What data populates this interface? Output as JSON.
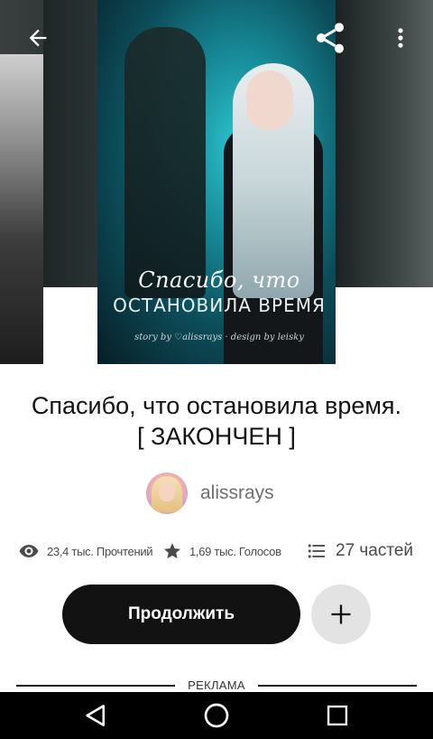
{
  "header": {
    "back_icon": "arrow-left-icon",
    "share_icon": "share-icon",
    "more_icon": "more-vertical-icon"
  },
  "cover": {
    "title_line1": "Спасибо, что",
    "title_line2": "ОСТАНОВИЛА ВРЕМЯ",
    "credit": "story by ♡alissrays · design by leisky"
  },
  "story": {
    "title": "Спасибо, что остановила время. [ ЗАКОНЧЕН ]"
  },
  "author": {
    "name": "alissrays"
  },
  "stats": {
    "reads": "23,4 тыс. Прочтений",
    "votes": "1,69 тыс. Голосов",
    "parts": "27 частей"
  },
  "actions": {
    "continue_label": "Продолжить",
    "add_icon": "plus-icon"
  },
  "ad": {
    "label": "РЕКЛАМА"
  },
  "nav_bar": {
    "back_icon": "nav-back-icon",
    "home_icon": "nav-home-icon",
    "recent_icon": "nav-recent-icon"
  }
}
